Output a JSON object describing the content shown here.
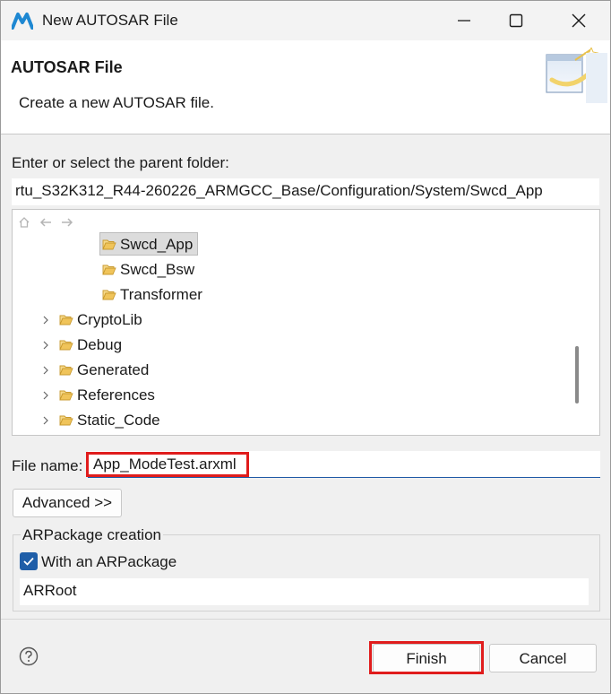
{
  "window": {
    "title": "New AUTOSAR File"
  },
  "banner": {
    "title": "AUTOSAR File",
    "description": "Create a new AUTOSAR file."
  },
  "folder": {
    "label": "Enter or select the parent folder:",
    "path": "rtu_S32K312_R44-260226_ARMGCC_Base/Configuration/System/Swcd_App"
  },
  "tree": {
    "items": [
      {
        "label": "Swcd_App",
        "depth": 2,
        "expandable": false,
        "selected": true
      },
      {
        "label": "Swcd_Bsw",
        "depth": 2,
        "expandable": false,
        "selected": false
      },
      {
        "label": "Transformer",
        "depth": 2,
        "expandable": false,
        "selected": false
      },
      {
        "label": "CryptoLib",
        "depth": 1,
        "expandable": true,
        "selected": false
      },
      {
        "label": "Debug",
        "depth": 1,
        "expandable": true,
        "selected": false
      },
      {
        "label": "Generated",
        "depth": 1,
        "expandable": true,
        "selected": false
      },
      {
        "label": "References",
        "depth": 1,
        "expandable": true,
        "selected": false
      },
      {
        "label": "Static_Code",
        "depth": 1,
        "expandable": true,
        "selected": false
      }
    ]
  },
  "file": {
    "label": "File name:",
    "value": "App_ModeTest.arxml"
  },
  "advanced_label": "Advanced >>",
  "arpackage": {
    "group_title": "ARPackage creation",
    "checkbox_label": "With an ARPackage",
    "checked": true,
    "name_value": "ARRoot"
  },
  "buttons": {
    "finish": "Finish",
    "cancel": "Cancel"
  },
  "colors": {
    "highlight_red": "#e01c1c",
    "accent_blue": "#1f5ea8",
    "folder_yellow": "#e8b84a"
  }
}
